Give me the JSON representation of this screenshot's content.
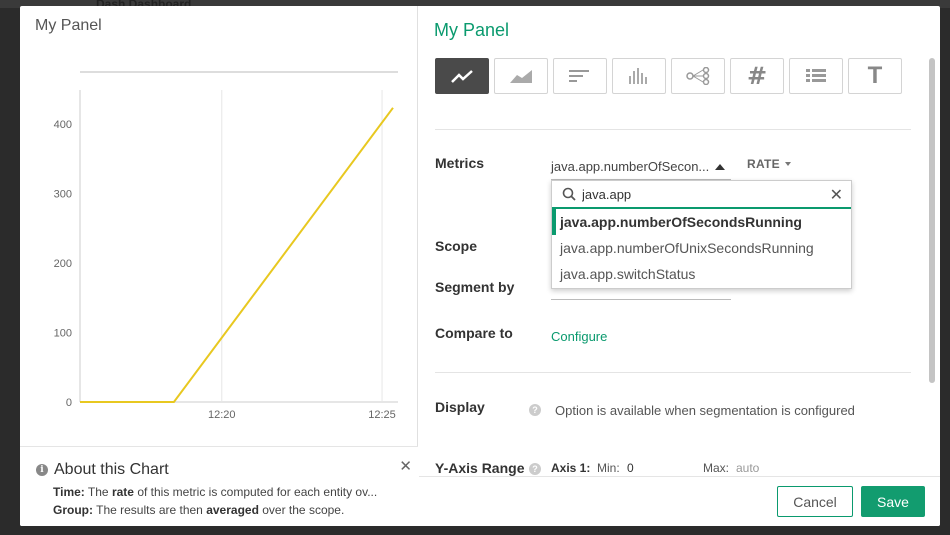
{
  "background": {
    "title_fragment": "Dash Dashboard"
  },
  "left": {
    "title": "My Panel",
    "about": {
      "heading": "About this Chart",
      "time_label": "Time:",
      "time_pre": "The",
      "time_bold": "rate",
      "time_post": "of this metric is computed for each entity ov...",
      "group_label": "Group:",
      "group_pre": "The results are then",
      "group_bold": "averaged",
      "group_post": "over the scope."
    }
  },
  "chart_data": {
    "type": "line",
    "x_tick_labels": [
      "12:20",
      "12:25"
    ],
    "y_ticks": [
      0,
      100,
      200,
      300,
      400
    ],
    "ylim": [
      0,
      440
    ],
    "series": [
      {
        "color": "#e8c820",
        "points": [
          [
            0,
            0
          ],
          [
            0.3,
            0
          ],
          [
            1.0,
            423
          ]
        ]
      }
    ]
  },
  "right": {
    "title": "My Panel",
    "chart_types": [
      {
        "name": "line-chart-icon",
        "active": true
      },
      {
        "name": "area-chart-icon",
        "active": false
      },
      {
        "name": "bar-chart-icon",
        "active": false
      },
      {
        "name": "histogram-icon",
        "active": false
      },
      {
        "name": "topology-icon",
        "active": false
      },
      {
        "name": "number-icon",
        "active": false
      },
      {
        "name": "table-icon",
        "active": false
      },
      {
        "name": "text-icon",
        "active": false
      }
    ],
    "metrics_label": "Metrics",
    "metric_value": "java.app.numberOfSecon...",
    "rate_label": "RATE",
    "search": {
      "value": "java.app"
    },
    "options": [
      "java.app.numberOfSecondsRunning",
      "java.app.numberOfUnixSecondsRunning",
      "java.app.switchStatus"
    ],
    "scope_label": "Scope",
    "segment_label": "Segment by",
    "compare_label": "Compare to",
    "configure_label": "Configure",
    "display_label": "Display",
    "display_note": "Option is available when segmentation is configured",
    "yaxis": {
      "label": "Y-Axis Range",
      "axis": "Axis 1:",
      "min_label": "Min:",
      "min_value": "0",
      "max_label": "Max:",
      "max_placeholder": "auto"
    },
    "cancel_label": "Cancel",
    "save_label": "Save"
  },
  "colors": {
    "accent": "#0a9a6e",
    "line": "#e8c820"
  }
}
